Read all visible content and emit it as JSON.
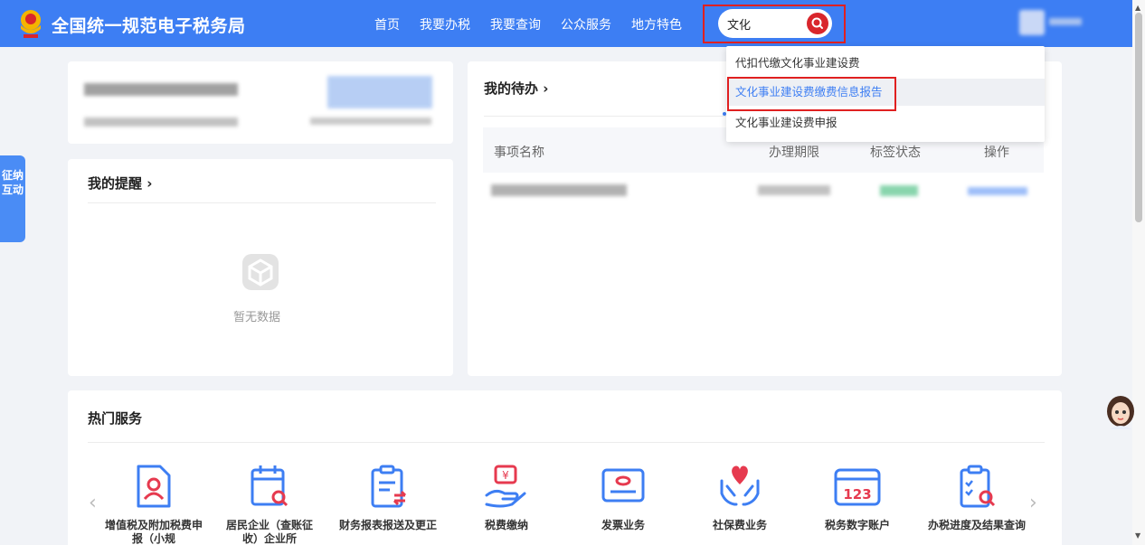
{
  "header": {
    "site_title": "全国统一规范电子税务局",
    "nav": [
      "首页",
      "我要办税",
      "我要查询",
      "公众服务",
      "地方特色"
    ],
    "search": {
      "value": "文化"
    }
  },
  "side_tab": {
    "label": "征纳互动"
  },
  "search_suggestions": [
    "代扣代缴文化事业建设费",
    "文化事业建设费缴费信息报告",
    "文化事业建设费申报"
  ],
  "reminders": {
    "title": "我的提醒",
    "empty_text": "暂无数据"
  },
  "todo": {
    "title": "我的待办",
    "columns": [
      "事项名称",
      "办理期限",
      "标签状态",
      "操作"
    ]
  },
  "hot_services": {
    "title": "热门服务",
    "items": [
      {
        "label": "增值税及附加税费申报（小规",
        "icon": "user-document-icon"
      },
      {
        "label": "居民企业（查账征收）企业所",
        "icon": "calendar-search-icon"
      },
      {
        "label": "财务报表报送及更正",
        "icon": "clipboard-transfer-icon"
      },
      {
        "label": "税费缴纳",
        "icon": "hand-yuan-icon"
      },
      {
        "label": "发票业务",
        "icon": "invoice-icon"
      },
      {
        "label": "社保费业务",
        "icon": "heart-hands-icon"
      },
      {
        "label": "税务数字账户",
        "icon": "digital-account-icon"
      },
      {
        "label": "办税进度及结果查询",
        "icon": "checklist-search-icon"
      }
    ]
  },
  "colors": {
    "header": "#3d7ef3",
    "accent_red": "#d9262c",
    "highlight": "#e02020"
  }
}
